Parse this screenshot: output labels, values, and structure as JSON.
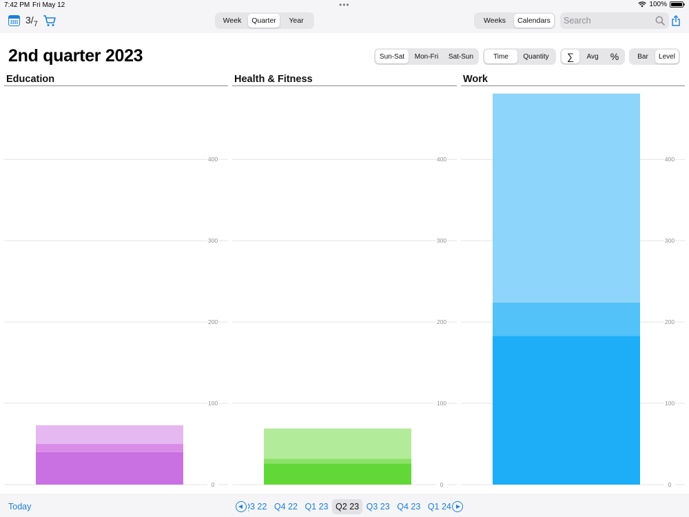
{
  "status": {
    "time": "7:42 PM",
    "date": "Fri May 12",
    "battery": "100%"
  },
  "toolbar": {
    "badge": "3",
    "badge_total": "7",
    "period_tabs": [
      {
        "label": "Week",
        "active": false
      },
      {
        "label": "Quarter",
        "active": true
      },
      {
        "label": "Year",
        "active": false
      }
    ],
    "view_tabs": [
      {
        "label": "Weeks",
        "active": false
      },
      {
        "label": "Calendars",
        "active": true
      }
    ],
    "search_placeholder": "Search"
  },
  "header": {
    "title": "2nd quarter 2023",
    "week_options": [
      {
        "label": "Sun-Sat",
        "active": true
      },
      {
        "label": "Mon-Fri",
        "active": false
      },
      {
        "label": "Sat-Sun",
        "active": false
      }
    ],
    "measure_options": [
      {
        "label": "Time",
        "active": true
      },
      {
        "label": "Quantity",
        "active": false
      }
    ],
    "aggregate_options": [
      {
        "label": "∑",
        "active": true
      },
      {
        "label": "Avg",
        "active": false
      },
      {
        "label": "%",
        "active": false
      }
    ],
    "style_options": [
      {
        "label": "Bar",
        "active": false
      },
      {
        "label": "Level",
        "active": true
      }
    ]
  },
  "chart_data": [
    {
      "type": "bar",
      "title": "Education",
      "y_ticks": [
        0,
        100,
        200,
        300,
        400
      ],
      "ylim": [
        0,
        485
      ],
      "segments": [
        {
          "value": 40,
          "color": "#c971e2"
        },
        {
          "value": 10,
          "color": "#d98de9"
        },
        {
          "value": 23,
          "color": "#e6b8f1"
        }
      ]
    },
    {
      "type": "bar",
      "title": "Health & Fitness",
      "y_ticks": [
        0,
        100,
        200,
        300,
        400
      ],
      "ylim": [
        0,
        485
      ],
      "segments": [
        {
          "value": 26,
          "color": "#62d838"
        },
        {
          "value": 6,
          "color": "#8be066"
        },
        {
          "value": 37,
          "color": "#b2eb99"
        }
      ]
    },
    {
      "type": "bar",
      "title": "Work",
      "y_ticks": [
        0,
        100,
        200,
        300,
        400
      ],
      "ylim": [
        0,
        485
      ],
      "segments": [
        {
          "value": 183,
          "color": "#1daef7"
        },
        {
          "value": 41,
          "color": "#52c2f8"
        },
        {
          "value": 257,
          "color": "#8ed5fb"
        }
      ]
    }
  ],
  "footer": {
    "today_label": "Today",
    "quarters": [
      {
        "label": "Q3 22",
        "active": false
      },
      {
        "label": "Q4 22",
        "active": false
      },
      {
        "label": "Q1 23",
        "active": false
      },
      {
        "label": "Q2 23",
        "active": true
      },
      {
        "label": "Q3 23",
        "active": false
      },
      {
        "label": "Q4 23",
        "active": false
      },
      {
        "label": "Q1 24",
        "active": false
      }
    ]
  }
}
